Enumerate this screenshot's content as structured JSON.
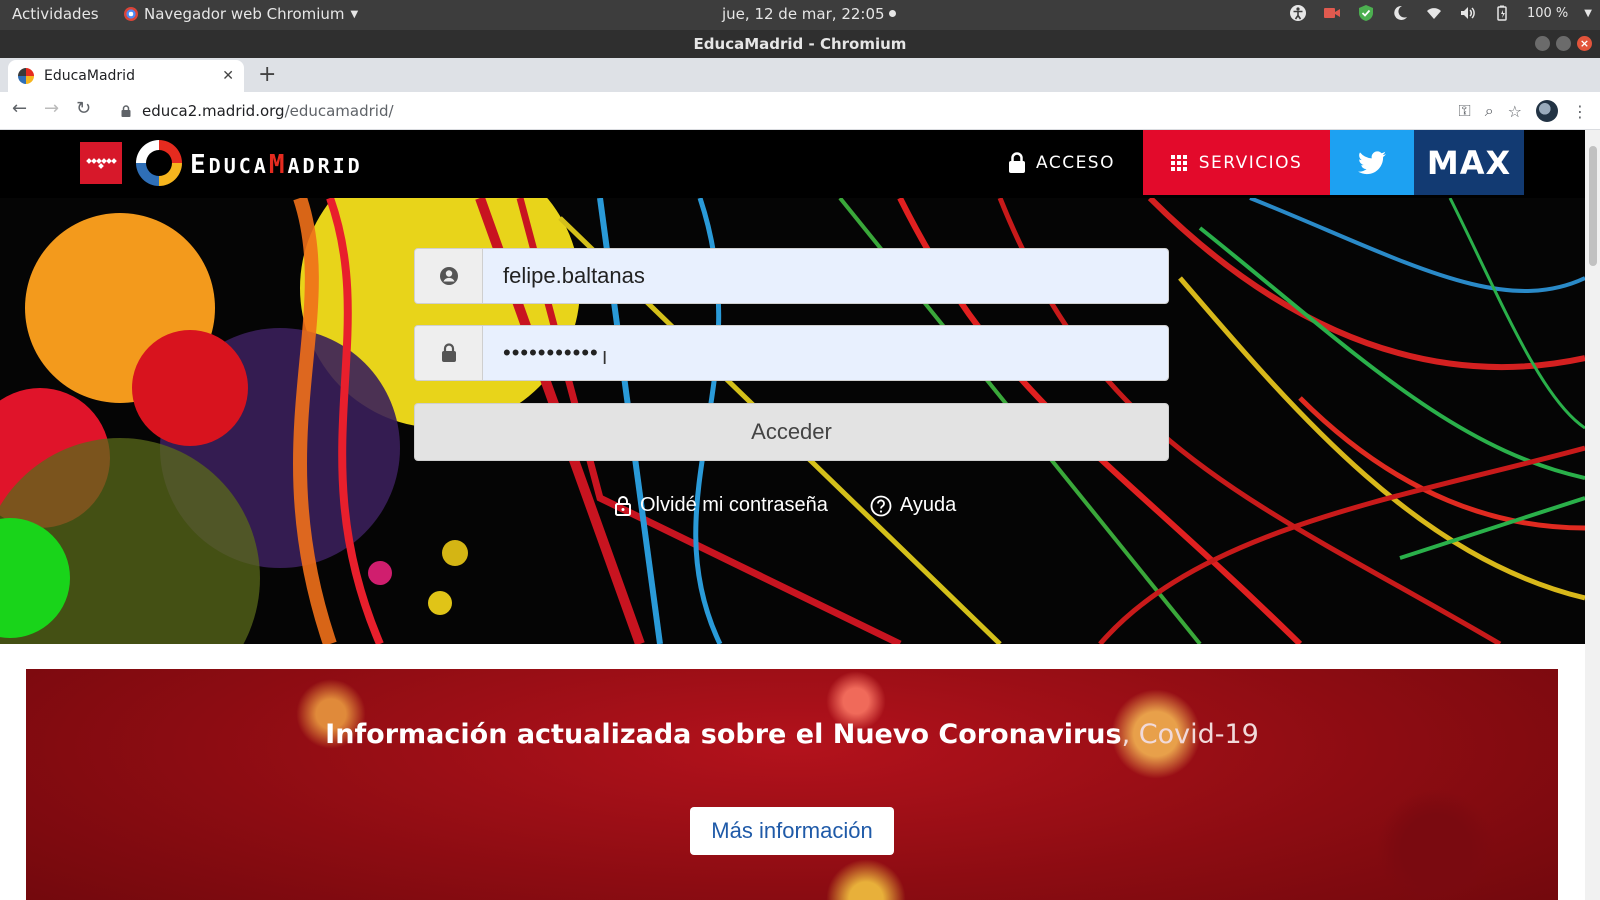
{
  "system_bar": {
    "activities": "Actividades",
    "app_menu": "Navegador web Chromium",
    "clock": "jue, 12 de mar, 22:05",
    "battery": "100 %"
  },
  "window": {
    "title": "EducaMadrid - Chromium"
  },
  "browser": {
    "tab_title": "EducaMadrid",
    "url_host": "educa2.madrid.org",
    "url_path": "/educamadrid/"
  },
  "site_header": {
    "logo_text_part1": "E",
    "logo_text_part2": "DUCA",
    "logo_text_part3": "M",
    "logo_text_part4": "ADRID",
    "nav_acceso": "ACCESO",
    "nav_servicios": "SERVICIOS",
    "nav_max": "MAX"
  },
  "login": {
    "username_value": "felipe.baltanas",
    "password_value": "•••••••••••",
    "submit_label": "Acceder",
    "forgot_label": "Olvidé mi contraseña",
    "help_label": "Ayuda"
  },
  "covid_banner": {
    "title_bold": "Información actualizada sobre el Nuevo Coronavirus",
    "title_light": ", Covid-19",
    "button_label": "Más información"
  },
  "colors": {
    "brand_red": "#e30a2b",
    "twitter_blue": "#1da1f2",
    "max_blue": "#123a72",
    "banner_red": "#9e0f17",
    "link_blue": "#1f5aa8"
  }
}
